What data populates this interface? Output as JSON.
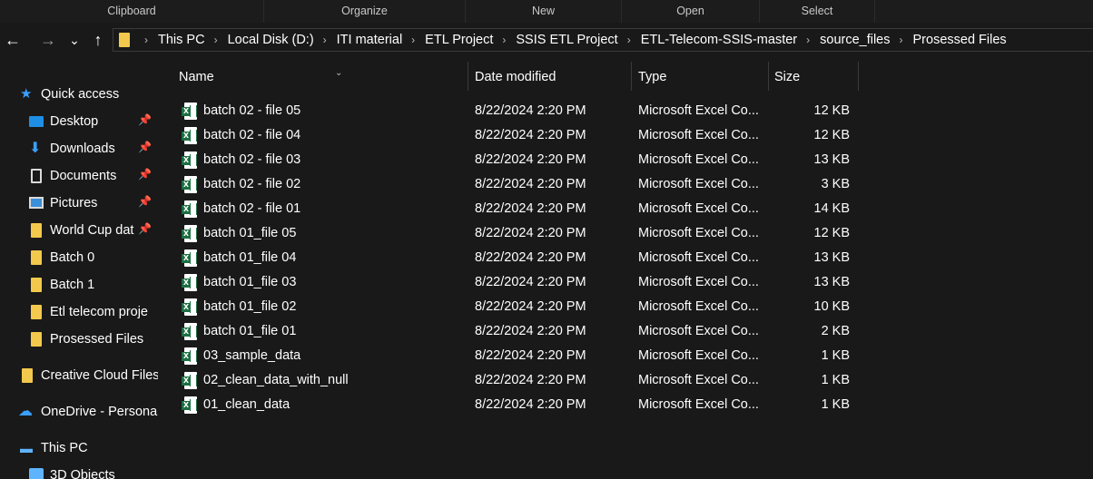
{
  "ribbon": {
    "groups": [
      "Clipboard",
      "Organize",
      "New",
      "Open",
      "Select"
    ]
  },
  "nav": {
    "back_icon": "←",
    "forward_icon": "→",
    "recent_icon": "⌄",
    "up_icon": "↑",
    "breadcrumbs": [
      "This PC",
      "Local Disk (D:)",
      "ITI material",
      "ETL Project",
      "SSIS ETL Project",
      "ETL-Telecom-SSIS-master",
      "source_files",
      "Prosessed Files"
    ]
  },
  "sidebar": {
    "quick_access": "Quick access",
    "items": [
      {
        "label": "Desktop",
        "icon": "desktop-icon",
        "pinned": true
      },
      {
        "label": "Downloads",
        "icon": "downloads-icon",
        "pinned": true
      },
      {
        "label": "Documents",
        "icon": "documents-icon",
        "pinned": true
      },
      {
        "label": "Pictures",
        "icon": "pictures-icon",
        "pinned": true
      },
      {
        "label": "World Cup dat",
        "icon": "folder-icon",
        "pinned": true
      },
      {
        "label": "Batch 0",
        "icon": "folder-icon",
        "pinned": false
      },
      {
        "label": "Batch 1",
        "icon": "folder-icon",
        "pinned": false
      },
      {
        "label": "Etl telecom proje",
        "icon": "folder-icon",
        "pinned": false
      },
      {
        "label": "Prosessed Files",
        "icon": "folder-icon",
        "pinned": false
      }
    ],
    "creative_cloud": "Creative Cloud Files",
    "onedrive": "OneDrive - Persona",
    "this_pc": "This PC",
    "objects_3d": "3D Objects",
    "pin_glyph": "📌"
  },
  "columns": {
    "name": "Name",
    "date": "Date modified",
    "type": "Type",
    "size": "Size"
  },
  "files": [
    {
      "name": "batch 02 - file 05",
      "date": "8/22/2024 2:20 PM",
      "type": "Microsoft Excel Co...",
      "size": "12 KB"
    },
    {
      "name": "batch 02 - file 04",
      "date": "8/22/2024 2:20 PM",
      "type": "Microsoft Excel Co...",
      "size": "12 KB"
    },
    {
      "name": "batch 02 - file 03",
      "date": "8/22/2024 2:20 PM",
      "type": "Microsoft Excel Co...",
      "size": "13 KB"
    },
    {
      "name": "batch 02 - file 02",
      "date": "8/22/2024 2:20 PM",
      "type": "Microsoft Excel Co...",
      "size": "3 KB"
    },
    {
      "name": "batch 02 - file 01",
      "date": "8/22/2024 2:20 PM",
      "type": "Microsoft Excel Co...",
      "size": "14 KB"
    },
    {
      "name": "batch 01_file 05",
      "date": "8/22/2024 2:20 PM",
      "type": "Microsoft Excel Co...",
      "size": "12 KB"
    },
    {
      "name": "batch 01_file 04",
      "date": "8/22/2024 2:20 PM",
      "type": "Microsoft Excel Co...",
      "size": "13 KB"
    },
    {
      "name": "batch 01_file 03",
      "date": "8/22/2024 2:20 PM",
      "type": "Microsoft Excel Co...",
      "size": "13 KB"
    },
    {
      "name": "batch 01_file 02",
      "date": "8/22/2024 2:20 PM",
      "type": "Microsoft Excel Co...",
      "size": "10 KB"
    },
    {
      "name": "batch 01_file 01",
      "date": "8/22/2024 2:20 PM",
      "type": "Microsoft Excel Co...",
      "size": "2 KB"
    },
    {
      "name": "03_sample_data",
      "date": "8/22/2024 2:20 PM",
      "type": "Microsoft Excel Co...",
      "size": "1 KB"
    },
    {
      "name": "02_clean_data_with_null",
      "date": "8/22/2024 2:20 PM",
      "type": "Microsoft Excel Co...",
      "size": "1 KB"
    },
    {
      "name": "01_clean_data",
      "date": "8/22/2024 2:20 PM",
      "type": "Microsoft Excel Co...",
      "size": "1 KB"
    }
  ],
  "colors": {
    "background": "#191919",
    "folder": "#f2c94c",
    "accent": "#3aa0ff",
    "excel_green": "#1d6f42"
  }
}
